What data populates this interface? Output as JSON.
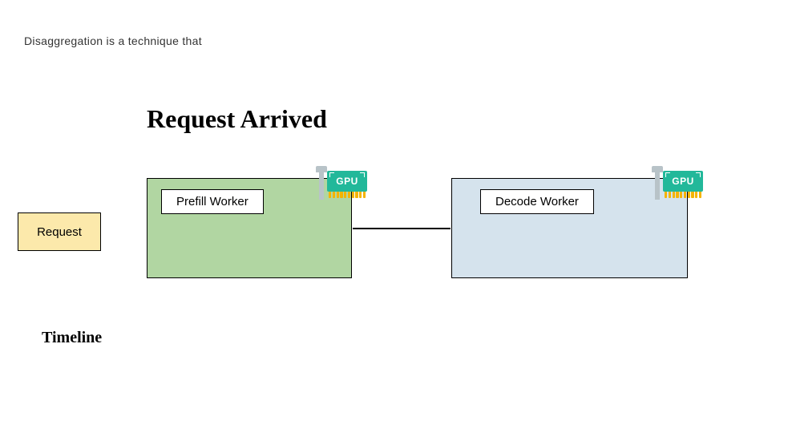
{
  "intro_text": "Disaggregation is a technique that",
  "diagram": {
    "title": "Request Arrived",
    "request_label": "Request",
    "prefill_worker_label": "Prefill Worker",
    "decode_worker_label": "Decode Worker",
    "timeline_label": "Timeline",
    "gpu_badge": "GPU"
  }
}
